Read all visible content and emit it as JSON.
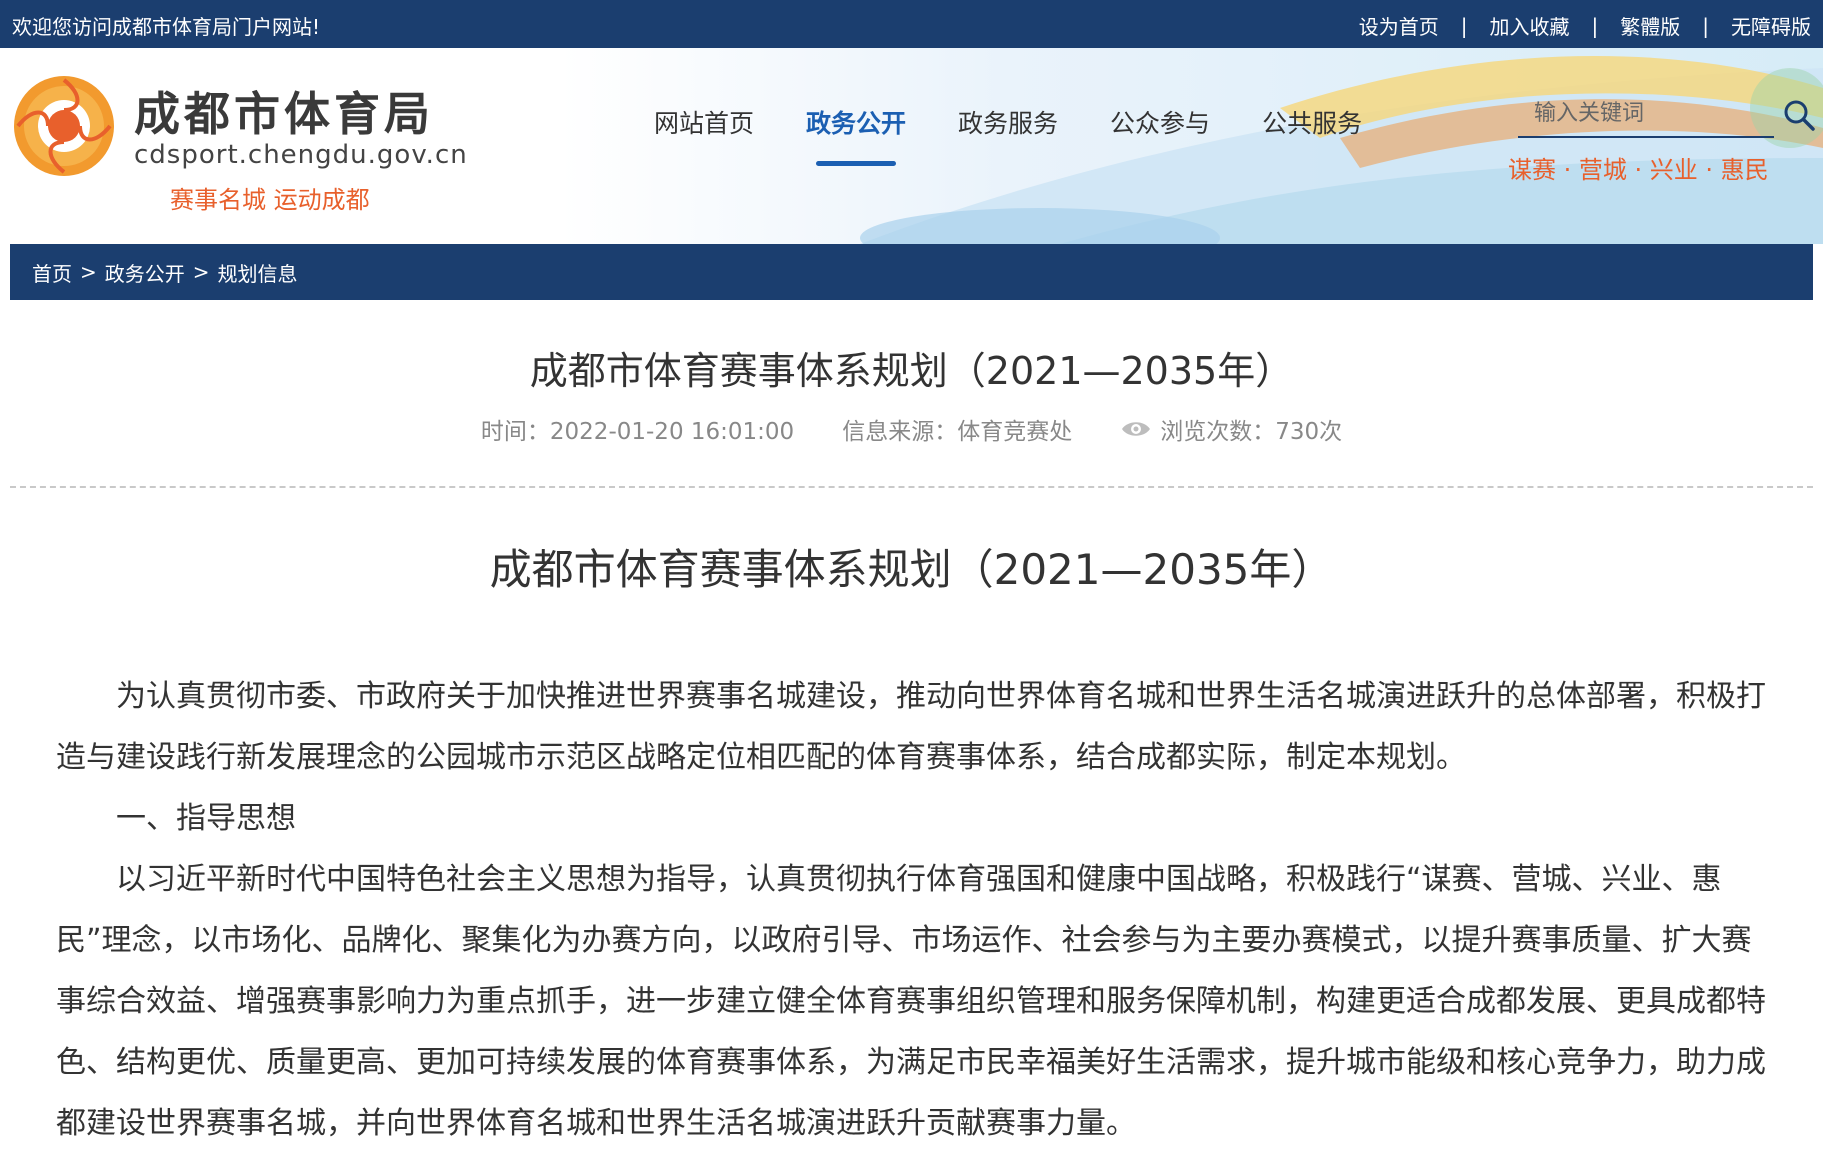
{
  "topbar": {
    "welcome": "欢迎您访问成都市体育局门户网站!",
    "links": [
      "设为首页",
      "加入收藏",
      "繁體版",
      "无障碍版"
    ],
    "separator": "|"
  },
  "logo": {
    "title": "成都市体育局",
    "domain": "cdsport.chengdu.gov.cn",
    "slogan": "赛事名城 运动成都"
  },
  "nav": {
    "items": [
      "网站首页",
      "政务公开",
      "政务服务",
      "公众参与",
      "公共服务"
    ],
    "active": "政务公开"
  },
  "search": {
    "placeholder": "输入关键词"
  },
  "tagline": "谋赛 · 营城 · 兴业 · 惠民",
  "breadcrumb": {
    "items": [
      "首页",
      "政务公开",
      "规划信息"
    ],
    "separator": ">"
  },
  "article": {
    "title": "成都市体育赛事体系规划（2021—2035年）",
    "time": "时间：2022-01-20 16:01:00",
    "source": "信息来源：体育竞赛处",
    "views": "浏览次数：730次"
  },
  "content": {
    "title": "成都市体育赛事体系规划（2021—2035年）",
    "paragraphs": [
      "为认真贯彻市委、市政府关于加快推进世界赛事名城建设，推动向世界体育名城和世界生活名城演进跃升的总体部署，积极打造与建设践行新发展理念的公园城市示范区战略定位相匹配的体育赛事体系，结合成都实际，制定本规划。",
      "一、指导思想",
      "以习近平新时代中国特色社会主义思想为指导，认真贯彻执行体育强国和健康中国战略，积极践行“谋赛、营城、兴业、惠民”理念，以市场化、品牌化、聚集化为办赛方向，以政府引导、市场运作、社会参与为主要办赛模式，以提升赛事质量、扩大赛事综合效益、增强赛事影响力为重点抓手，进一步建立健全体育赛事组织管理和服务保障机制，构建更适合成都发展、更具成都特色、结构更优、质量更高、更加可持续发展的体育赛事体系，为满足市民幸福美好生活需求，提升城市能级和核心竞争力，助力成都建设世界赛事名城，并向世界体育名城和世界生活名城演进跃升贡献赛事力量。"
    ]
  },
  "colors": {
    "primary": "#1b3e6f",
    "accent": "#1b5fb2",
    "orange": "#e8602c"
  }
}
